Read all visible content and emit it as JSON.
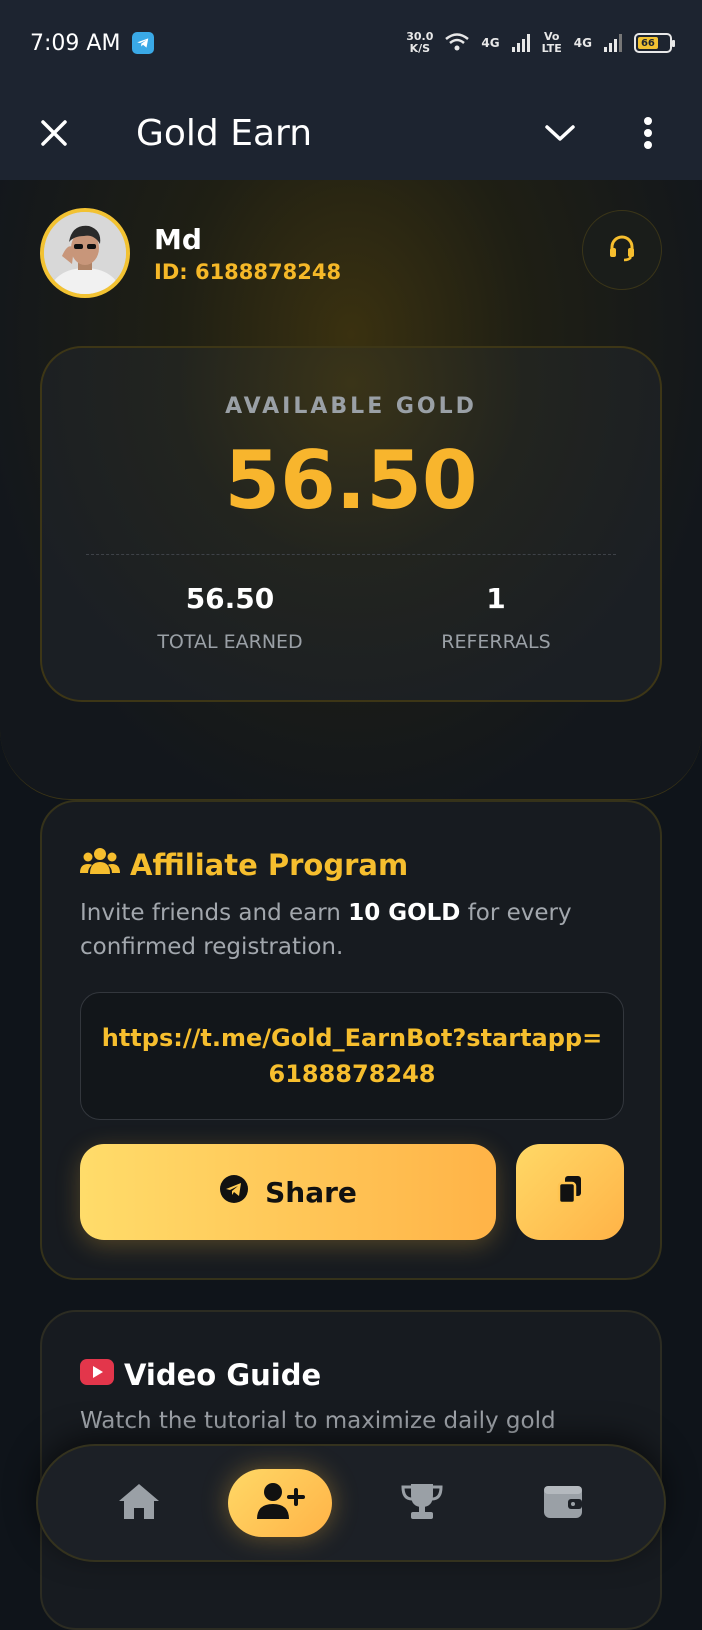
{
  "status_bar": {
    "time": "7:09 AM",
    "net_speed_value": "30.0",
    "net_speed_unit": "K/S",
    "net1": "4G",
    "volte_top": "Vo",
    "volte_bottom": "LTE",
    "net2": "4G",
    "battery": "66",
    "battery_level": 0.66
  },
  "title_bar": {
    "title": "Gold Earn"
  },
  "profile": {
    "name": "Md",
    "id_text": "ID: 6188878248"
  },
  "gold_card": {
    "label": "AVAILABLE GOLD",
    "value": "56.50",
    "stats": [
      {
        "value": "56.50",
        "label": "TOTAL EARNED"
      },
      {
        "value": "1",
        "label": "REFERRALS"
      }
    ]
  },
  "affiliate": {
    "title": "Affiliate Program",
    "desc_before": "Invite friends and earn ",
    "desc_bold": "10 GOLD",
    "desc_after": " for every confirmed registration.",
    "link": "https://t.me/Gold_EarnBot?startapp=6188878248",
    "share_label": "Share"
  },
  "video_guide": {
    "title": "Video Guide",
    "desc": "Watch the tutorial to maximize daily gold"
  },
  "colors": {
    "accent": "#f6be2e",
    "background": "#0f141a",
    "card": "#171b20"
  },
  "nav": [
    "home-icon",
    "add-user-icon",
    "trophy-icon",
    "wallet-icon"
  ]
}
